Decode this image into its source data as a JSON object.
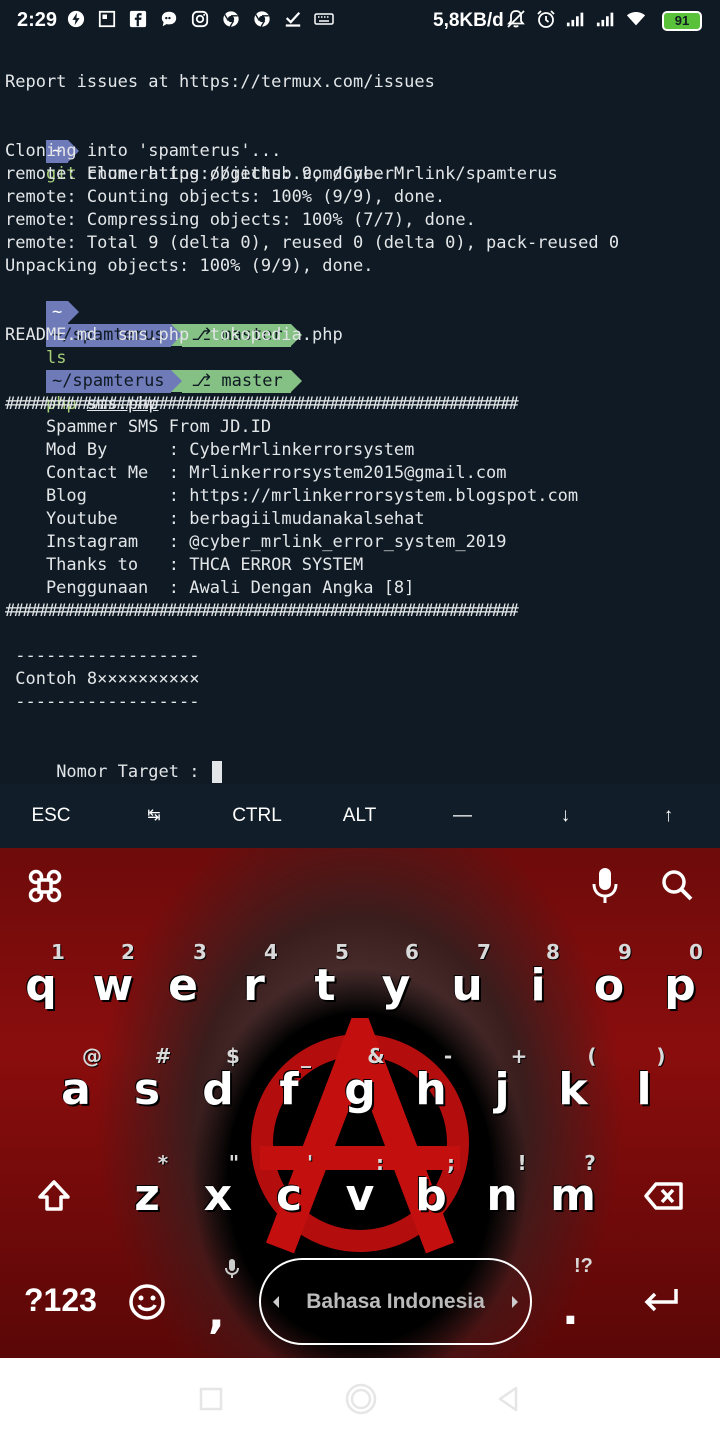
{
  "status_bar": {
    "time": "2:29",
    "network_speed": "5,8KB/d",
    "battery_level": "91",
    "left_icons": [
      "flash-icon",
      "square-icon",
      "facebook-icon",
      "chat-icon",
      "instagram-icon",
      "chrome-icon",
      "chrome-icon",
      "check-icon",
      "keyboard-icon"
    ],
    "right_icons": [
      "mute-bell-icon",
      "alarm-icon",
      "signal-icon",
      "signal-icon",
      "wifi-icon"
    ]
  },
  "terminal": {
    "report_line": "Report issues at https://termux.com/issues",
    "prompt_home": "~",
    "prompt_dir": "~/spamterus",
    "git_branch": "⎇ master",
    "cmd1_git": "git",
    "cmd1_rest": " clone https://github.com/CyberMrlink/spamterus",
    "clone_output": [
      "Cloning into 'spamterus'...",
      "remote: Enumerating objects: 9, done.",
      "remote: Counting objects: 100% (9/9), done.",
      "remote: Compressing objects: 100% (7/7), done.",
      "remote: Total 9 (delta 0), reused 0 (delta 0), pack-reused 0",
      "Unpacking objects: 100% (9/9), done."
    ],
    "cmd2_cd": "cd",
    "cmd2_arg": "spamterus",
    "cmd3_ls": "ls",
    "ls_output": "README.md  sms.php  tokopedia.php",
    "cmd4_php": "php",
    "cmd4_arg": "sms.php",
    "hash_bar": "############################################################",
    "banner": [
      "    Spammer SMS From JD.ID",
      "    Mod By      : CyberMrlinkerrorsystem",
      "    Contact Me  : Mrlinkerrorsystem2015@gmail.com",
      "    Blog        : https://mrlinkerrorsystem.blogspot.com",
      "    Youtube     : berbagiilmudanakalsehat",
      "    Instagram   : @cyber_mrlink_error_system_2019",
      "    Thanks to   : THCA ERROR SYSTEM",
      "    Penggunaan  : Awali Dengan Angka [8]"
    ],
    "dash_line": " ------------------",
    "example_line": " Contoh 8××××××××××",
    "input_prompt": " Nomor Target : "
  },
  "extra_keys": {
    "esc": "ESC",
    "tab": "↹",
    "ctrl": "CTRL",
    "alt": "ALT",
    "dash": "—",
    "down": "↓",
    "up": "↑"
  },
  "keyboard": {
    "row1": {
      "keys": [
        "q",
        "w",
        "e",
        "r",
        "t",
        "y",
        "u",
        "i",
        "o",
        "p"
      ],
      "hints": [
        "1",
        "2",
        "3",
        "4",
        "5",
        "6",
        "7",
        "8",
        "9",
        "0"
      ]
    },
    "row2": {
      "keys": [
        "a",
        "s",
        "d",
        "f",
        "g",
        "h",
        "j",
        "k",
        "l"
      ],
      "hints": [
        "@",
        "#",
        "$",
        "_",
        "&",
        "-",
        "+",
        "(",
        ")"
      ]
    },
    "row3": {
      "keys": [
        "z",
        "x",
        "c",
        "v",
        "b",
        "n",
        "m"
      ],
      "hints": [
        "*",
        "\"",
        "'",
        ":",
        ";",
        "!",
        "?"
      ]
    },
    "symbols_label": "?123",
    "comma": ",",
    "period": ".",
    "period_hint": "!?",
    "space_label": "Bahasa Indonesia"
  },
  "colors": {
    "terminal_bg": "#0f1a24",
    "prompt_blue": "#6f7ab8",
    "prompt_green": "#85c084",
    "battery_green": "#59c23a"
  }
}
